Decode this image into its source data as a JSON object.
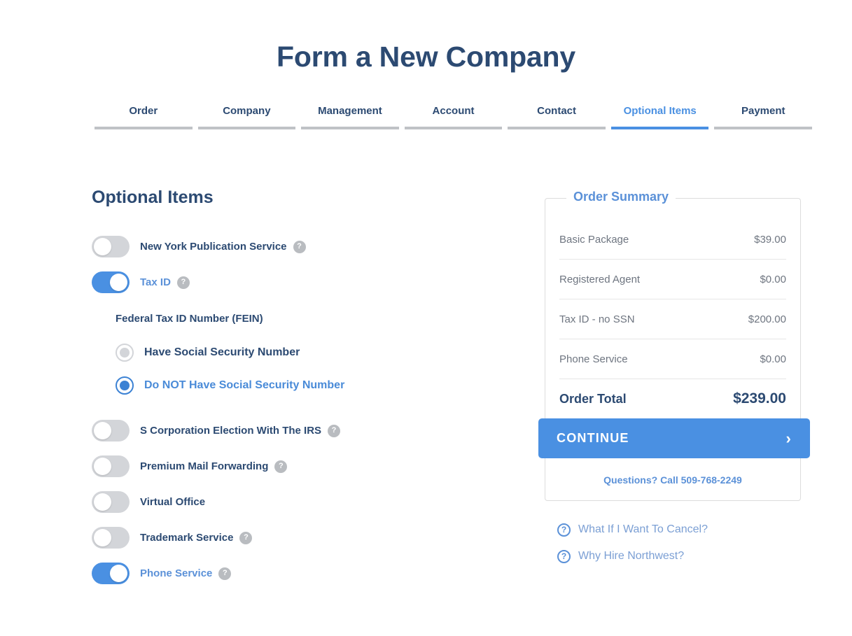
{
  "header": {
    "title": "Form a New Company"
  },
  "tabs": [
    {
      "label": "Order",
      "active": false
    },
    {
      "label": "Company",
      "active": false
    },
    {
      "label": "Management",
      "active": false
    },
    {
      "label": "Account",
      "active": false
    },
    {
      "label": "Contact",
      "active": false
    },
    {
      "label": "Optional Items",
      "active": true
    },
    {
      "label": "Payment",
      "active": false
    }
  ],
  "main": {
    "section_title": "Optional Items",
    "options_top": [
      {
        "label": "New York Publication Service",
        "on": false,
        "help": true
      },
      {
        "label": "Tax ID",
        "on": true,
        "help": true
      }
    ],
    "fein": {
      "title": "Federal Tax ID Number (FEIN)",
      "choices": [
        {
          "label": "Have Social Security Number",
          "selected": false
        },
        {
          "label": "Do NOT Have Social Security Number",
          "selected": true
        }
      ]
    },
    "options_bottom": [
      {
        "label": "S Corporation Election With The IRS",
        "on": false,
        "help": true
      },
      {
        "label": "Premium Mail Forwarding",
        "on": false,
        "help": true
      },
      {
        "label": "Virtual Office",
        "on": false,
        "help": false
      },
      {
        "label": "Trademark Service",
        "on": false,
        "help": true
      },
      {
        "label": "Phone Service",
        "on": true,
        "help": true
      }
    ],
    "help_icon_glyph": "?"
  },
  "order_summary": {
    "legend": "Order Summary",
    "line_items": [
      {
        "label": "Basic Package",
        "amount": "$39.00"
      },
      {
        "label": "Registered Agent",
        "amount": "$0.00"
      },
      {
        "label": "Tax ID - no SSN",
        "amount": "$200.00"
      },
      {
        "label": "Phone Service",
        "amount": "$0.00"
      }
    ],
    "total_label": "Order Total",
    "total_amount": "$239.00",
    "continue_label": "CONTINUE",
    "continue_chevron": "›",
    "questions_text": "Questions? Call 509-768-2249"
  },
  "footer_links": [
    {
      "label": "What If I Want To Cancel?",
      "icon_glyph": "?"
    },
    {
      "label": "Why Hire Northwest?",
      "icon_glyph": "?"
    }
  ],
  "colors": {
    "navy": "#2c4a72",
    "accent_blue": "#4a90e2",
    "light_blue": "#5b91d8",
    "toggle_off": "#d3d5d9",
    "muted_text": "#6e7580",
    "divider": "#e6e6e6"
  }
}
